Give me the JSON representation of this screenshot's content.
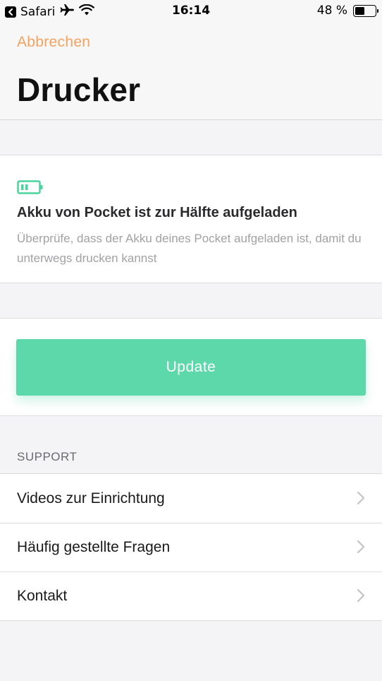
{
  "status_bar": {
    "back_app": "Safari",
    "time": "16:14",
    "battery_percent_label": "48 %",
    "battery_level": 0.48
  },
  "nav": {
    "cancel_label": "Abbrechen",
    "title": "Drucker"
  },
  "battery_card": {
    "icon": "battery-half-icon",
    "title": "Akku von Pocket ist zur Hälfte aufgeladen",
    "description": "Überprüfe, dass der Akku deines Pocket aufgeladen ist, damit du unterwegs drucken kannst"
  },
  "update": {
    "button_label": "Update"
  },
  "support": {
    "header": "SUPPORT",
    "items": [
      {
        "label": "Videos zur Einrichtung",
        "icon": "chevron-right-icon"
      },
      {
        "label": "Häufig gestellte Fragen",
        "icon": "chevron-right-icon"
      },
      {
        "label": "Kontakt",
        "icon": "chevron-right-icon"
      }
    ]
  },
  "colors": {
    "accent_orange": "#f2a35e",
    "accent_green": "#5dd8ab",
    "background": "#f4f4f6"
  }
}
